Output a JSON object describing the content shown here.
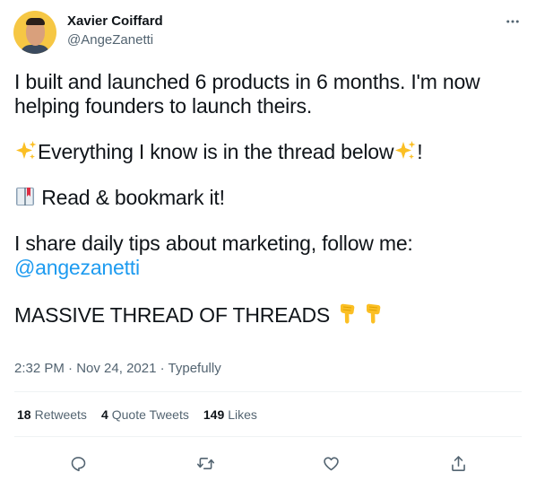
{
  "author": {
    "name": "Xavier Coiffard",
    "handle": "@AngeZanetti"
  },
  "tweet": {
    "line1": "I built and launched 6 products in 6 months. I'm now",
    "line2": "helping founders to launch theirs.",
    "line3_text": "Everything I know is in the thread below",
    "line3_end": "!",
    "line4_text": " Read & bookmark it!",
    "line5": "I share daily tips about marketing, follow me:",
    "mention": "@angezanetti",
    "line7_text": "MASSIVE THREAD OF THREADS "
  },
  "meta": {
    "time": "2:32 PM",
    "date": "Nov 24, 2021",
    "source": "Typefully",
    "separator": " · "
  },
  "stats": {
    "retweets_count": "18",
    "retweets_label": "Retweets",
    "quotes_count": "4",
    "quotes_label": "Quote Tweets",
    "likes_count": "149",
    "likes_label": "Likes"
  },
  "icons": {
    "more": "more-horizontal-icon",
    "sparkles": "sparkles-icon",
    "book": "book-icon",
    "pointing_down": "pointing-down-icon",
    "reply": "reply-icon",
    "retweet": "retweet-icon",
    "like": "heart-icon",
    "share": "share-icon"
  },
  "colors": {
    "link": "#1d9bf0",
    "secondary_text": "#536471",
    "primary_text": "#0f1419",
    "divider": "#eff3f4",
    "emoji_yellow": "#fbbf24"
  }
}
